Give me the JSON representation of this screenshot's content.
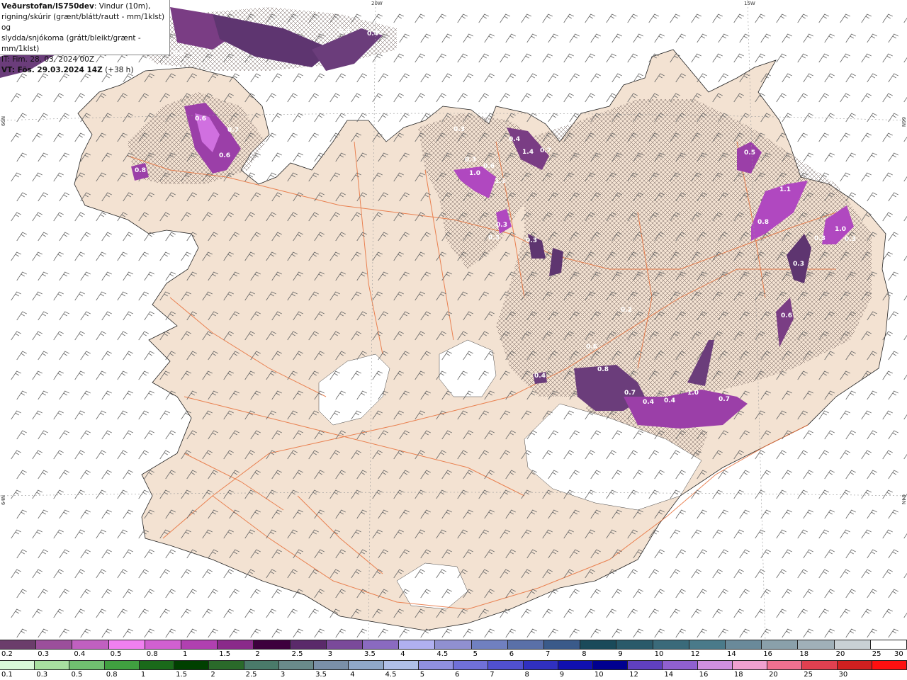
{
  "header": {
    "title": "Veðurstofan/IS750dev",
    "line1_rest": ": Vindur (10m),",
    "line2": "rigning/skúrir (grænt/blátt/rautt - mm/1klst) og",
    "line3": "slydda/snjókoma (grátt/bleikt/grænt - mm/1klst)",
    "line4": "IT: Fim. 28. 03. 2024 00Z",
    "line5_bold": "VT: Fös. 29.03.2024 14Z",
    "line5_rest": " (+38 h)"
  },
  "graticule": {
    "lon_20w": "20W",
    "lon_15w": "15W",
    "lat_66n_left": "66N",
    "lat_66n_right": "66N",
    "lat_64n_left": "64N",
    "lat_64n_right": "64N"
  },
  "precip_labels": [
    "0.4",
    "0.4",
    "0.6",
    "0.6",
    "0.7",
    "0.6",
    "0.8",
    "0.3",
    "0.3",
    "1.0",
    "0.6",
    "1.1",
    "0.4",
    "1.4",
    "0.7",
    "0.3",
    "0.3",
    "0.3",
    "0.5",
    "1.1",
    "0.8",
    "0.3",
    "1.0",
    "0.3",
    "0.6",
    "0.2",
    "0.6",
    "0.8",
    "0.7",
    "0.4",
    "1.0",
    "0.4",
    "0.7",
    "0.4",
    "0.3"
  ],
  "legend": {
    "snow_colors": [
      "#6b3d6b",
      "#9b4f9b",
      "#c060c0",
      "#f080f0",
      "#d060d0",
      "#b040b0",
      "#8a2a8a",
      "#3d003d",
      "#5a2a6a",
      "#7a4a9a",
      "#8a6ac0",
      "#b0b0f0",
      "#9090d0",
      "#7080c0",
      "#5a70a8",
      "#3a5a8a",
      "#1a4a5a",
      "#2a5a6a",
      "#3a6a7a",
      "#4a7a8a",
      "#6a8a9a",
      "#8aa0aa",
      "#a0b0b8",
      "#c8d0d4",
      "#ffffff"
    ],
    "snow_labels": [
      "0.2",
      "0.3",
      "0.4",
      "0.5",
      "0.8",
      "1",
      "1.5",
      "2",
      "2.5",
      "3",
      "3.5",
      "4",
      "4.5",
      "5",
      "6",
      "7",
      "8",
      "9",
      "10",
      "12",
      "14",
      "16",
      "18",
      "20",
      "25",
      "30"
    ],
    "rain_colors": [
      "#d8f8d8",
      "#a8e0a0",
      "#70c070",
      "#40a040",
      "#1a6a1a",
      "#004000",
      "#2a6a2a",
      "#4a7a6a",
      "#6a8a8a",
      "#7a90a8",
      "#90a8c8",
      "#b0c0e8",
      "#9090e0",
      "#7070d8",
      "#5050d0",
      "#3030c0",
      "#1010b0",
      "#000090",
      "#6040c0",
      "#9060d0",
      "#d090e0",
      "#f0a0d0",
      "#f07090",
      "#e04050",
      "#d02020",
      "#ff1010"
    ],
    "rain_labels": [
      "0.1",
      "0.3",
      "0.5",
      "0.8",
      "1",
      "1.5",
      "2",
      "2.5",
      "3",
      "3.5",
      "4",
      "4.5",
      "5",
      "6",
      "7",
      "8",
      "9",
      "10",
      "12",
      "14",
      "16",
      "18",
      "20",
      "25",
      "30"
    ]
  }
}
